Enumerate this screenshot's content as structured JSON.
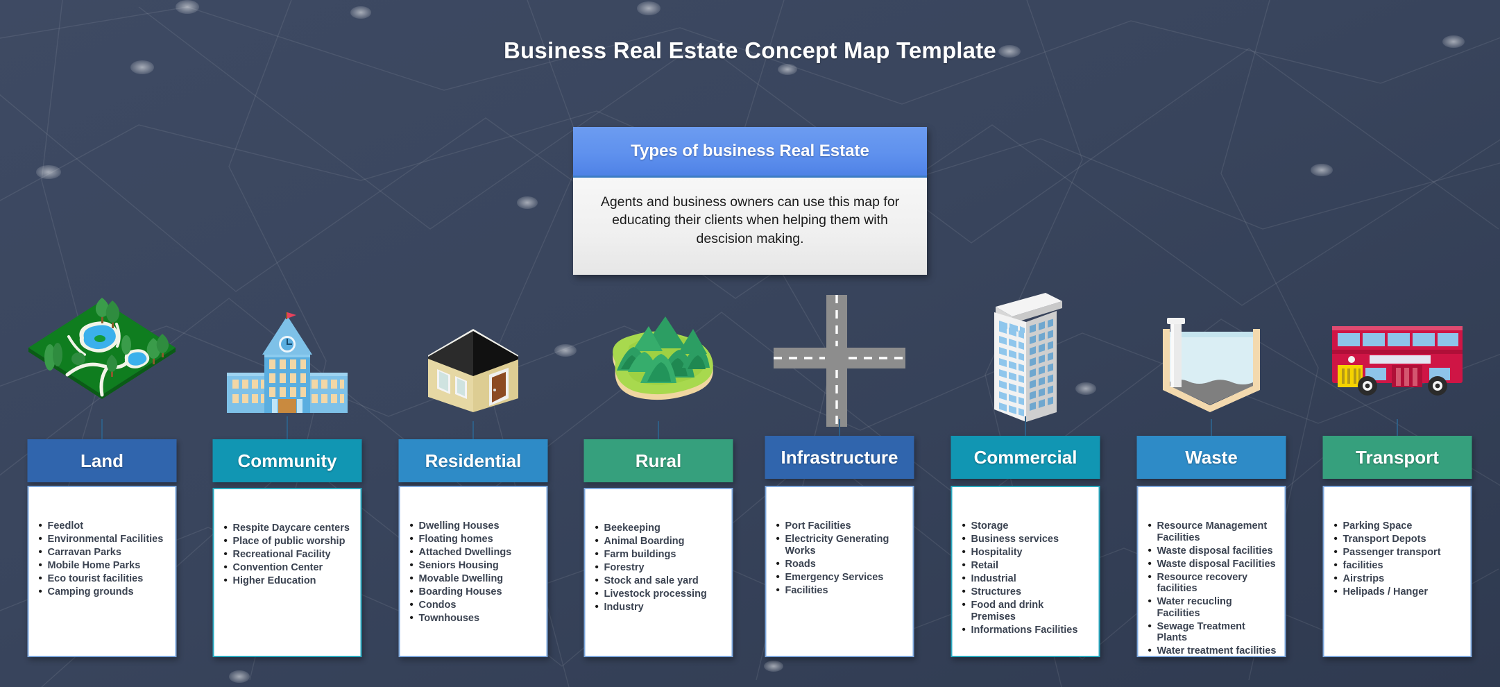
{
  "page": {
    "title": "Business Real Estate Concept Map Template",
    "background_color": "#3a465e"
  },
  "concept": {
    "heading": "Types of business Real Estate",
    "description": "Agents and business owners can use this map for educating their clients when helping them with descision making.",
    "header_color": "#5f91ee"
  },
  "columns": [
    {
      "id": "land",
      "label": "Land",
      "color": "#3065ad",
      "icon": "isometric-park-land-icon",
      "items": [
        "Feedlot",
        "Environmental Facilities",
        "Carravan Parks",
        "Mobile Home Parks",
        "Eco tourist facilities",
        "Camping grounds"
      ]
    },
    {
      "id": "community",
      "label": "Community",
      "color": "#1196b3",
      "icon": "town-hall-building-icon",
      "items": [
        "Respite Daycare centers",
        "Place of public worship",
        "Recreational Facility",
        "Convention Center",
        "Higher Education"
      ]
    },
    {
      "id": "residential",
      "label": "Residential",
      "color": "#2e8bc7",
      "icon": "house-icon",
      "items": [
        "Dwelling Houses",
        "Floating homes",
        "Attached Dwellings",
        "Seniors Housing",
        "Movable Dwelling",
        "Boarding Houses",
        "Condos",
        "Townhouses"
      ]
    },
    {
      "id": "rural",
      "label": "Rural",
      "color": "#36a07d",
      "icon": "forest-hills-island-icon",
      "items": [
        "Beekeeping",
        "Animal Boarding",
        "Farm buildings",
        "Forestry",
        "Stock and sale yard",
        "Livestock processing",
        "Industry"
      ]
    },
    {
      "id": "infrastructure",
      "label": "Infrastructure",
      "color": "#3065ad",
      "icon": "crossroads-icon",
      "items": [
        "Port Facilities",
        "Electricity Generating Works",
        "Roads",
        "Emergency Services",
        "Facilities"
      ]
    },
    {
      "id": "commercial",
      "label": "Commercial",
      "color": "#1196b3",
      "icon": "office-tower-icon",
      "items": [
        "Storage",
        "Business services",
        "Hospitality",
        "Retail",
        "Industrial",
        "Structures",
        "Food and drink Premises",
        "Informations Facilities"
      ]
    },
    {
      "id": "waste",
      "label": "Waste",
      "color": "#2e8bc7",
      "icon": "water-treatment-tank-icon",
      "items": [
        "Resource Management Facilities",
        "Waste disposal facilities",
        "Waste disposal Facilities",
        "Resource recovery facilities",
        "Water recucling Facilities",
        "Sewage Treatment Plants",
        "Water treatment facilities"
      ]
    },
    {
      "id": "transport",
      "label": "Transport",
      "color": "#36a07d",
      "icon": "double-decker-bus-icon",
      "items": [
        "Parking Space",
        "Transport Depots",
        "Passenger transport",
        "facilities",
        "Airstrips",
        "Helipads / Hanger"
      ]
    }
  ]
}
